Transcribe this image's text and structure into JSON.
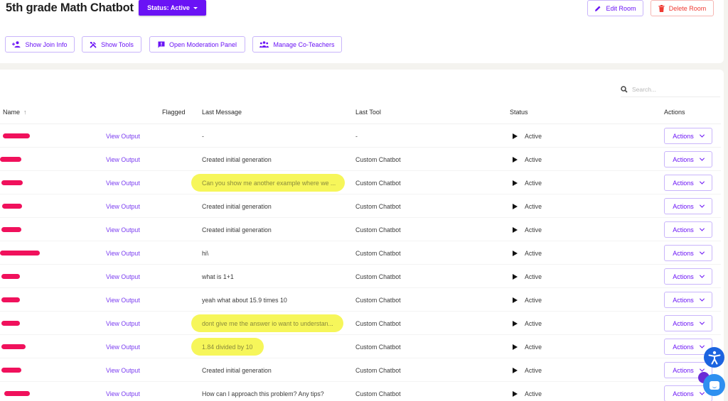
{
  "header": {
    "title": "5th grade Math Chatbot",
    "status_button": "Status: Active",
    "edit_room": "Edit Room",
    "delete_room": "Delete Room"
  },
  "toolbar": {
    "show_join_info": "Show Join Info",
    "show_tools": "Show Tools",
    "open_moderation_panel": "Open Moderation Panel",
    "manage_co_teachers": "Manage Co-Teachers"
  },
  "search": {
    "placeholder": "Search...",
    "value": ""
  },
  "table": {
    "columns": {
      "name": "Name",
      "name_sort": "↑",
      "flagged": "Flagged",
      "last_message": "Last Message",
      "last_tool": "Last Tool",
      "status": "Status",
      "actions": "Actions"
    },
    "rows": [
      {
        "name": "[redacted]",
        "view": "View Output",
        "last_message": "-",
        "last_tool": "-",
        "status": "Active",
        "actions": "Actions",
        "highlighted": false
      },
      {
        "name": "[redacted]",
        "view": "View Output",
        "last_message": "Created initial generation",
        "last_tool": "Custom Chatbot",
        "status": "Active",
        "actions": "Actions",
        "highlighted": false
      },
      {
        "name": "[redacted]",
        "view": "View Output",
        "last_message": "Can you show me another example where we ...",
        "last_tool": "Custom Chatbot",
        "status": "Active",
        "actions": "Actions",
        "highlighted": true
      },
      {
        "name": "[redacted]",
        "view": "View Output",
        "last_message": "Created initial generation",
        "last_tool": "Custom Chatbot",
        "status": "Active",
        "actions": "Actions",
        "highlighted": false
      },
      {
        "name": "[redacted]",
        "view": "View Output",
        "last_message": "Created initial generation",
        "last_tool": "Custom Chatbot",
        "status": "Active",
        "actions": "Actions",
        "highlighted": false
      },
      {
        "name": "[redacted]",
        "view": "View Output",
        "last_message": "hi\\",
        "last_tool": "Custom Chatbot",
        "status": "Active",
        "actions": "Actions",
        "highlighted": false
      },
      {
        "name": "[redacted]",
        "view": "View Output",
        "last_message": "what is 1+1",
        "last_tool": "Custom Chatbot",
        "status": "Active",
        "actions": "Actions",
        "highlighted": false
      },
      {
        "name": "[redacted]",
        "view": "View Output",
        "last_message": "yeah what about 15.9 times 10",
        "last_tool": "Custom Chatbot",
        "status": "Active",
        "actions": "Actions",
        "highlighted": false
      },
      {
        "name": "[redacted]",
        "view": "View Output",
        "last_message": "dont give me the answer io want to understan...",
        "last_tool": "Custom Chatbot",
        "status": "Active",
        "actions": "Actions",
        "highlighted": true
      },
      {
        "name": "[redacted]",
        "view": "View Output",
        "last_message": "1.84 divided by 10",
        "last_tool": "Custom Chatbot",
        "status": "Active",
        "actions": "Actions",
        "highlighted": true
      },
      {
        "name": "[redacted]",
        "view": "View Output",
        "last_message": "Created initial generation",
        "last_tool": "Custom Chatbot",
        "status": "Active",
        "actions": "Actions",
        "highlighted": false
      },
      {
        "name": "[redacted]",
        "view": "View Output",
        "last_message": "How can I approach this problem? Any tips?",
        "last_tool": "Custom Chatbot",
        "status": "Active",
        "actions": "Actions",
        "highlighted": false
      }
    ]
  },
  "colors": {
    "accent": "#6a13f5",
    "danger": "#ef3b33",
    "highlight": "#f6f65a",
    "redaction": "#f0115c"
  }
}
